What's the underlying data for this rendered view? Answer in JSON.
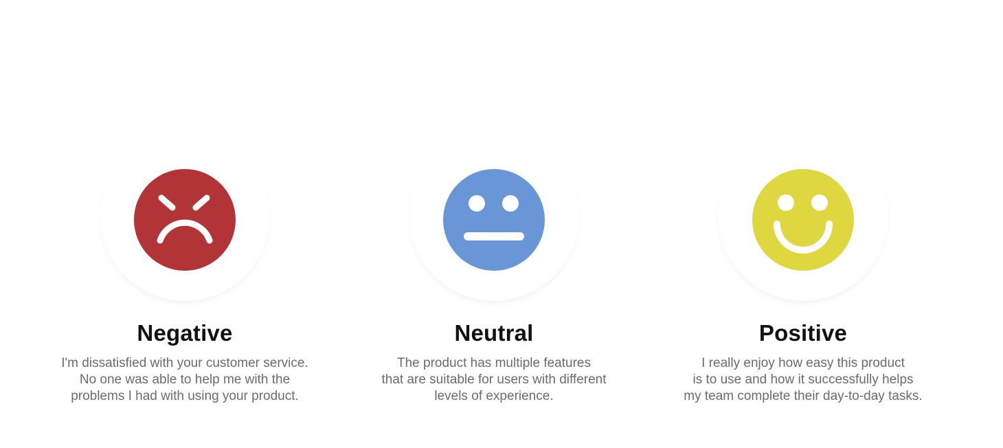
{
  "feedback_options": [
    {
      "key": "negative",
      "title": "Negative",
      "description_lines": [
        "I'm dissatisfied with your customer service.",
        "No one was able to help me with the",
        "problems I had with using your product."
      ],
      "icon": "angry-face-icon",
      "color": "#b33437"
    },
    {
      "key": "neutral",
      "title": "Neutral",
      "description_lines": [
        "The product has multiple features",
        "that are suitable for users with different",
        "levels of experience."
      ],
      "icon": "neutral-face-icon",
      "color": "#6896d6"
    },
    {
      "key": "positive",
      "title": "Positive",
      "description_lines": [
        "I really enjoy how easy this product",
        "is to use and how it successfully helps",
        "my team complete their day-to-day tasks."
      ],
      "icon": "smiling-face-icon",
      "color": "#dfd740"
    }
  ]
}
